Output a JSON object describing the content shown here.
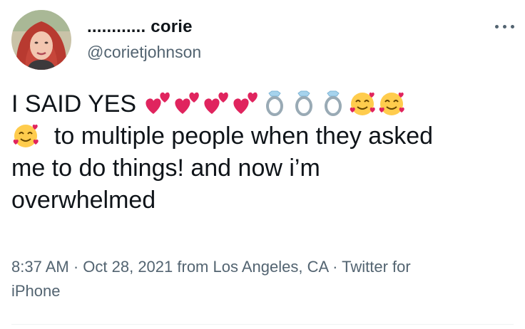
{
  "author": {
    "display_name": "............ corie",
    "handle": "@corietjohnson"
  },
  "tweet": {
    "text_prefix": "I SAID YES",
    "line2_text": "to multiple people when they asked",
    "line3_text": "me to do things! and now i’m",
    "line4_text": "overwhelmed",
    "emojis": [
      "two-hearts",
      "two-hearts",
      "two-hearts",
      "two-hearts",
      "ring",
      "ring",
      "ring",
      "smiling-face-with-hearts",
      "smiling-face-with-hearts",
      "smiling-face-with-hearts"
    ]
  },
  "meta": {
    "time": "8:37 AM",
    "separator": " · ",
    "date": "Oct 28, 2021",
    "location_prefix": " from ",
    "location": "Los Angeles, CA",
    "source_prefix": "Twitter for",
    "source_suffix": "iPhone"
  },
  "colors": {
    "text": "#0f1419",
    "secondary": "#536471",
    "heart": "#e0245e",
    "ring_metal": "#99aab5",
    "ring_gem": "#a6d3ed",
    "face": "#ffcc4d"
  }
}
